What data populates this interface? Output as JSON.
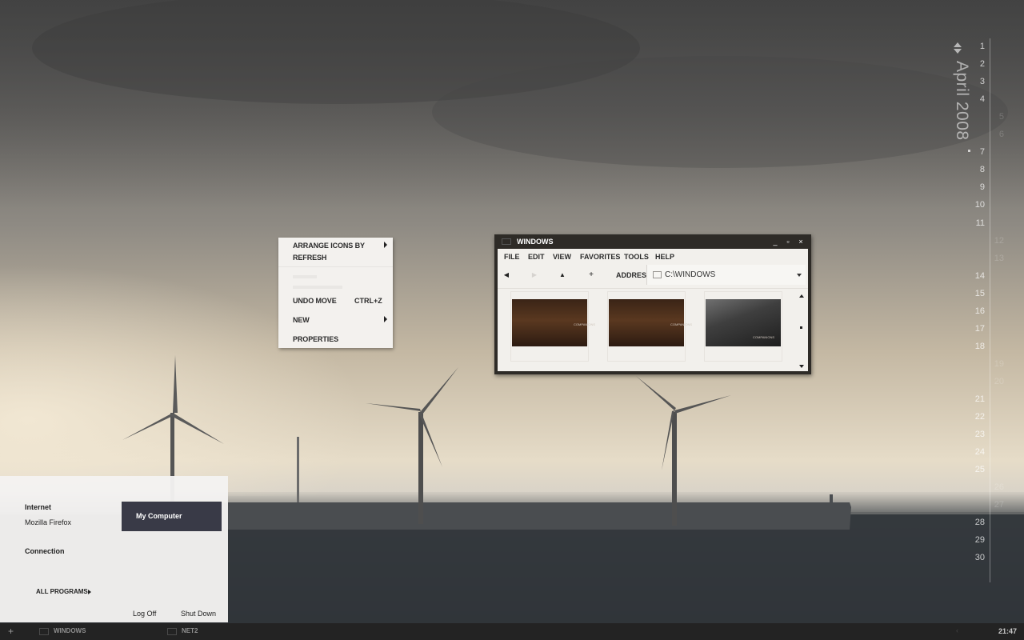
{
  "calendar": {
    "month_year": "April 2008",
    "days": [
      "1",
      "2",
      "3",
      "4",
      "5",
      "6",
      "7",
      "8",
      "9",
      "10",
      "11",
      "12",
      "13",
      "14",
      "15",
      "16",
      "17",
      "18",
      "19",
      "20",
      "21",
      "22",
      "23",
      "24",
      "25",
      "26",
      "27",
      "28",
      "29",
      "30"
    ]
  },
  "context_menu": {
    "arrange": "ARRANGE ICONS BY",
    "refresh": "REFRESH",
    "undo": "UNDO MOVE",
    "undo_shortcut": "CTRL+Z",
    "new": "NEW",
    "properties": "PROPERTIES"
  },
  "window": {
    "title": "WINDOWS",
    "minimize": "_",
    "maximize": "▫",
    "close": "×",
    "menu": [
      "FILE",
      "EDIT",
      "VIEW",
      "FAVORITES",
      "TOOLS",
      "HELP"
    ],
    "toolbar": {
      "back": "◀",
      "forward": "▶",
      "up": "▲",
      "new_folder": "+",
      "address_label": "ADDRESS",
      "address_value": "C:\\WINDOWS"
    },
    "thumbnails": [
      {
        "caption": "COMPANIONS"
      },
      {
        "caption": "COMPANIONS"
      },
      {
        "caption": "COMPANIONS"
      }
    ]
  },
  "start_menu": {
    "internet_label": "Internet",
    "internet_app": "Mozilla Firefox",
    "connection_label": "Connection",
    "my_computer": "My Computer",
    "all_programs": "ALL PROGRAMS",
    "log_off": "Log Off",
    "shut_down": "Shut Down"
  },
  "taskbar": {
    "start": "+",
    "tasks": [
      "WINDOWS",
      "NET2"
    ],
    "clock": "21:47"
  }
}
